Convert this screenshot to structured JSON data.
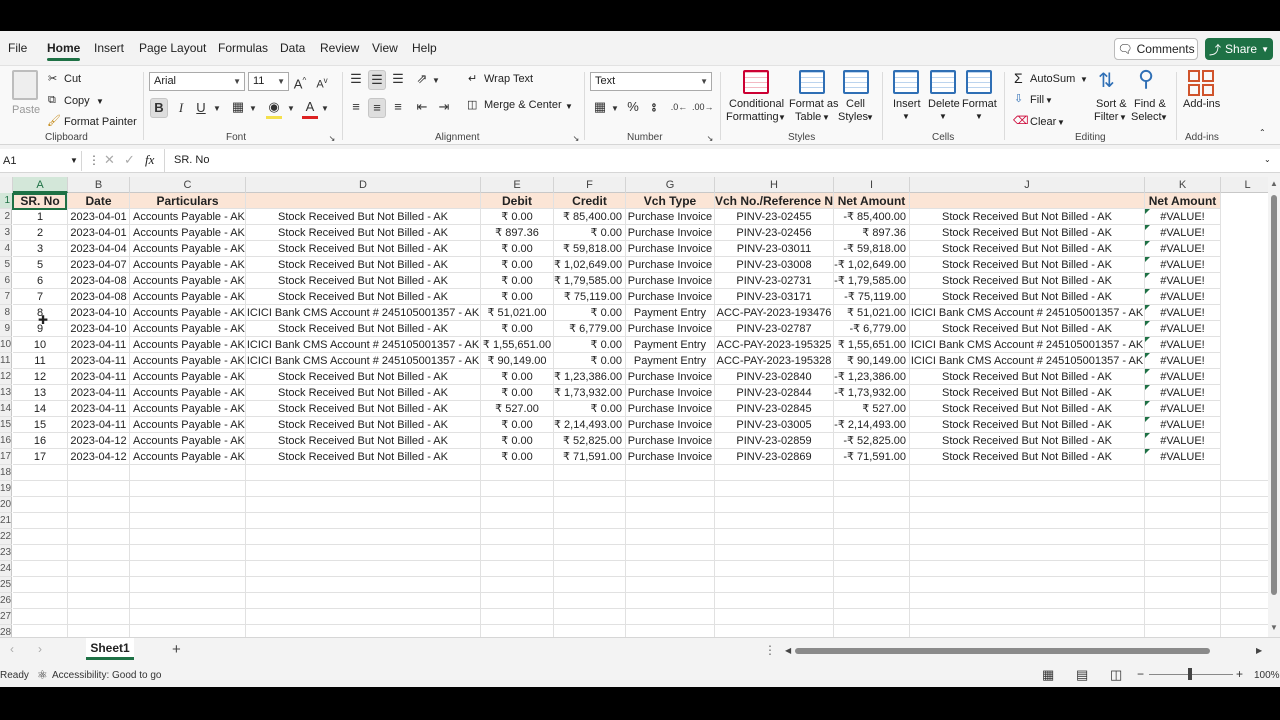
{
  "menu": {
    "items": [
      "File",
      "Home",
      "Insert",
      "Page Layout",
      "Formulas",
      "Data",
      "Review",
      "View",
      "Help"
    ],
    "active": "Home",
    "comments_label": "Comments",
    "share_label": "Share"
  },
  "ribbon": {
    "clipboard": {
      "paste": "Paste",
      "cut": "Cut",
      "copy": "Copy",
      "format_painter": "Format Painter",
      "group": "Clipboard"
    },
    "font": {
      "name": "Arial",
      "size": "11",
      "bold": "B",
      "italic": "I",
      "underline": "U",
      "group": "Font"
    },
    "alignment": {
      "wrap_text": "Wrap Text",
      "merge_center": "Merge & Center",
      "group": "Alignment"
    },
    "number": {
      "format": "Text",
      "group": "Number"
    },
    "styles": {
      "conditional": "Conditional",
      "formatting": "Formatting",
      "format_as": "Format as",
      "table": "Table",
      "cell": "Cell",
      "cell_styles": "Styles",
      "group": "Styles"
    },
    "cells": {
      "insert": "Insert",
      "delete": "Delete",
      "format": "Format",
      "group": "Cells"
    },
    "editing": {
      "autosum": "AutoSum",
      "fill": "Fill",
      "clear": "Clear",
      "sort": "Sort &",
      "filter": "Filter",
      "find": "Find &",
      "select": "Select",
      "group": "Editing"
    },
    "addins": {
      "label": "Add-ins",
      "group": "Add-ins"
    }
  },
  "formula_bar": {
    "name_box": "A1",
    "fx": "fx",
    "content": "SR. No"
  },
  "columns": [
    "A",
    "B",
    "C",
    "D",
    "E",
    "F",
    "G",
    "H",
    "I",
    "J",
    "K",
    "L"
  ],
  "headers": [
    "SR. No",
    "Date",
    "Particulars",
    "",
    "Debit",
    "Credit",
    "Vch Type",
    "Vch No./Reference No",
    "Net Amount",
    "",
    "Net Amount"
  ],
  "rows": [
    [
      "1",
      "2023-04-01",
      "Accounts Payable - AK",
      "Stock Received But Not Billed - AK",
      "₹ 0.00",
      "₹ 85,400.00",
      "Purchase Invoice",
      "PINV-23-02455",
      "-₹ 85,400.00",
      "Stock Received But Not Billed - AK",
      "#VALUE!"
    ],
    [
      "2",
      "2023-04-01",
      "Accounts Payable - AK",
      "Stock Received But Not Billed - AK",
      "₹ 897.36",
      "₹ 0.00",
      "Purchase Invoice",
      "PINV-23-02456",
      "₹ 897.36",
      "Stock Received But Not Billed - AK",
      "#VALUE!"
    ],
    [
      "3",
      "2023-04-04",
      "Accounts Payable - AK",
      "Stock Received But Not Billed - AK",
      "₹ 0.00",
      "₹ 59,818.00",
      "Purchase Invoice",
      "PINV-23-03011",
      "-₹ 59,818.00",
      "Stock Received But Not Billed - AK",
      "#VALUE!"
    ],
    [
      "5",
      "2023-04-07",
      "Accounts Payable - AK",
      "Stock Received But Not Billed - AK",
      "₹ 0.00",
      "₹ 1,02,649.00",
      "Purchase Invoice",
      "PINV-23-03008",
      "-₹ 1,02,649.00",
      "Stock Received But Not Billed - AK",
      "#VALUE!"
    ],
    [
      "6",
      "2023-04-08",
      "Accounts Payable - AK",
      "Stock Received But Not Billed - AK",
      "₹ 0.00",
      "₹ 1,79,585.00",
      "Purchase Invoice",
      "PINV-23-02731",
      "-₹ 1,79,585.00",
      "Stock Received But Not Billed - AK",
      "#VALUE!"
    ],
    [
      "7",
      "2023-04-08",
      "Accounts Payable - AK",
      "Stock Received But Not Billed - AK",
      "₹ 0.00",
      "₹ 75,119.00",
      "Purchase Invoice",
      "PINV-23-03171",
      "-₹ 75,119.00",
      "Stock Received But Not Billed - AK",
      "#VALUE!"
    ],
    [
      "8",
      "2023-04-10",
      "Accounts Payable - AK",
      "ICICI Bank CMS Account # 245105001357 - AK",
      "₹ 51,021.00",
      "₹ 0.00",
      "Payment Entry",
      "ACC-PAY-2023-193476",
      "₹ 51,021.00",
      "ICICI Bank CMS Account # 245105001357 - AK",
      "#VALUE!"
    ],
    [
      "9",
      "2023-04-10",
      "Accounts Payable - AK",
      "Stock Received But Not Billed - AK",
      "₹ 0.00",
      "₹ 6,779.00",
      "Purchase Invoice",
      "PINV-23-02787",
      "-₹ 6,779.00",
      "Stock Received But Not Billed - AK",
      "#VALUE!"
    ],
    [
      "10",
      "2023-04-11",
      "Accounts Payable - AK",
      "ICICI Bank CMS Account # 245105001357 - AK",
      "₹ 1,55,651.00",
      "₹ 0.00",
      "Payment Entry",
      "ACC-PAY-2023-195325",
      "₹ 1,55,651.00",
      "ICICI Bank CMS Account # 245105001357 - AK",
      "#VALUE!"
    ],
    [
      "11",
      "2023-04-11",
      "Accounts Payable - AK",
      "ICICI Bank CMS Account # 245105001357 - AK",
      "₹ 90,149.00",
      "₹ 0.00",
      "Payment Entry",
      "ACC-PAY-2023-195328",
      "₹ 90,149.00",
      "ICICI Bank CMS Account # 245105001357 - AK",
      "#VALUE!"
    ],
    [
      "12",
      "2023-04-11",
      "Accounts Payable - AK",
      "Stock Received But Not Billed - AK",
      "₹ 0.00",
      "₹ 1,23,386.00",
      "Purchase Invoice",
      "PINV-23-02840",
      "-₹ 1,23,386.00",
      "Stock Received But Not Billed - AK",
      "#VALUE!"
    ],
    [
      "13",
      "2023-04-11",
      "Accounts Payable - AK",
      "Stock Received But Not Billed - AK",
      "₹ 0.00",
      "₹ 1,73,932.00",
      "Purchase Invoice",
      "PINV-23-02844",
      "-₹ 1,73,932.00",
      "Stock Received But Not Billed - AK",
      "#VALUE!"
    ],
    [
      "14",
      "2023-04-11",
      "Accounts Payable - AK",
      "Stock Received But Not Billed - AK",
      "₹ 527.00",
      "₹ 0.00",
      "Purchase Invoice",
      "PINV-23-02845",
      "₹ 527.00",
      "Stock Received But Not Billed - AK",
      "#VALUE!"
    ],
    [
      "15",
      "2023-04-11",
      "Accounts Payable - AK",
      "Stock Received But Not Billed - AK",
      "₹ 0.00",
      "₹ 2,14,493.00",
      "Purchase Invoice",
      "PINV-23-03005",
      "-₹ 2,14,493.00",
      "Stock Received But Not Billed - AK",
      "#VALUE!"
    ],
    [
      "16",
      "2023-04-12",
      "Accounts Payable - AK",
      "Stock Received But Not Billed - AK",
      "₹ 0.00",
      "₹ 52,825.00",
      "Purchase Invoice",
      "PINV-23-02859",
      "-₹ 52,825.00",
      "Stock Received But Not Billed - AK",
      "#VALUE!"
    ],
    [
      "17",
      "2023-04-12",
      "Accounts Payable - AK",
      "Stock Received But Not Billed - AK",
      "₹ 0.00",
      "₹ 71,591.00",
      "Purchase Invoice",
      "PINV-23-02869",
      "-₹ 71,591.00",
      "Stock Received But Not Billed - AK",
      "#VALUE!"
    ]
  ],
  "row_numbers": [
    "1",
    "2",
    "3",
    "4",
    "5",
    "6",
    "7",
    "8",
    "9",
    "10",
    "11",
    "12",
    "13",
    "14",
    "15",
    "16",
    "17",
    "18",
    "19",
    "20",
    "21",
    "22",
    "23",
    "24",
    "25",
    "26",
    "27",
    "28"
  ],
  "sheet": {
    "tab": "Sheet1",
    "add": "+"
  },
  "status": {
    "ready": "Ready",
    "accessibility": "Accessibility: Good to go",
    "zoom": "100%"
  },
  "colors": {
    "accent": "#1e7145",
    "header_fill": "#fbe5d6"
  }
}
